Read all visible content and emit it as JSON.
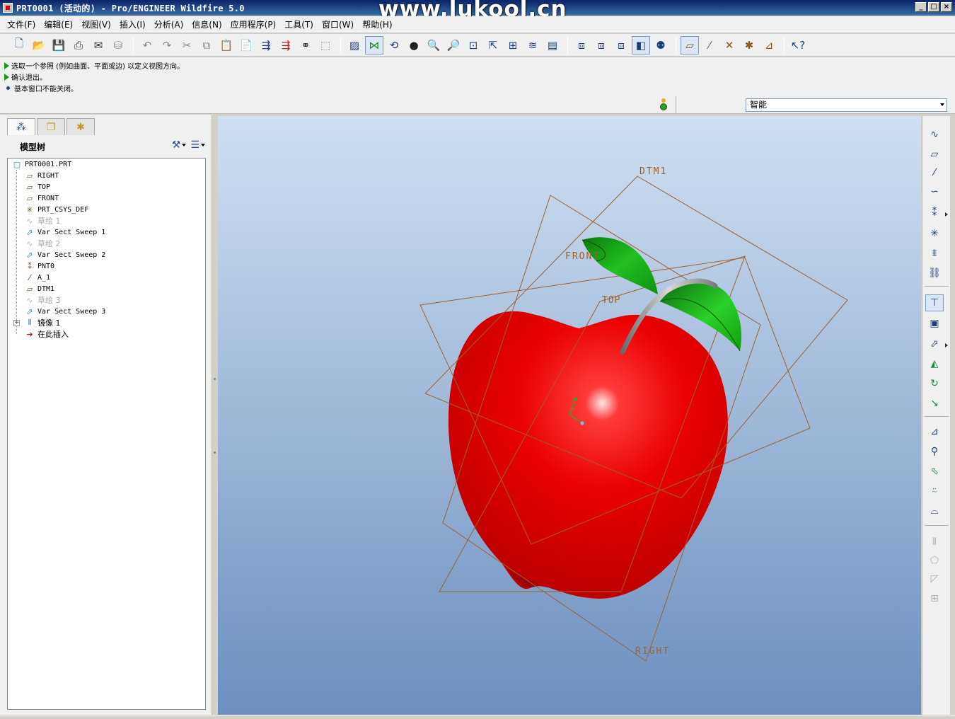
{
  "window": {
    "title": "PRT0001 (活动的) - Pro/ENGINEER Wildfire 5.0",
    "watermark": "www.lukool.cn",
    "buttons": {
      "minimize": "_",
      "maximize": "□",
      "close": "×"
    }
  },
  "menu": {
    "items": [
      "文件(F)",
      "编辑(E)",
      "视图(V)",
      "插入(I)",
      "分析(A)",
      "信息(N)",
      "应用程序(P)",
      "工具(T)",
      "窗口(W)",
      "帮助(H)"
    ]
  },
  "messages": [
    {
      "type": "prompt",
      "text": "选取一个参照 (例如曲面、平面或边) 以定义视图方向。"
    },
    {
      "type": "prompt",
      "text": "确认退出。"
    },
    {
      "type": "info",
      "text": "基本窗口不能关闭。"
    }
  ],
  "filter": {
    "value": "智能"
  },
  "model_tree": {
    "title": "模型树",
    "items": [
      {
        "label": "PRT0001.PRT",
        "icon": "part-icon",
        "state": "normal"
      },
      {
        "label": "RIGHT",
        "icon": "datum-plane-icon",
        "state": "normal"
      },
      {
        "label": "TOP",
        "icon": "datum-plane-icon",
        "state": "normal"
      },
      {
        "label": "FRONT",
        "icon": "datum-plane-icon",
        "state": "normal"
      },
      {
        "label": "PRT_CSYS_DEF",
        "icon": "csys-icon",
        "state": "normal"
      },
      {
        "label": "草绘 1",
        "icon": "sketch-icon",
        "state": "hidden"
      },
      {
        "label": "Var Sect Sweep 1",
        "icon": "var-sect-sweep-icon",
        "state": "normal"
      },
      {
        "label": "草绘 2",
        "icon": "sketch-icon",
        "state": "hidden"
      },
      {
        "label": "Var Sect Sweep 2",
        "icon": "var-sect-sweep-icon",
        "state": "normal"
      },
      {
        "label": "PNT0",
        "icon": "datum-point-icon",
        "state": "normal"
      },
      {
        "label": "A_1",
        "icon": "datum-axis-icon",
        "state": "normal"
      },
      {
        "label": "DTM1",
        "icon": "datum-plane-icon",
        "state": "normal"
      },
      {
        "label": "草绘 3",
        "icon": "sketch-icon",
        "state": "hidden"
      },
      {
        "label": "Var Sect Sweep 3",
        "icon": "var-sect-sweep-icon",
        "state": "normal"
      },
      {
        "label": "镜像 1",
        "icon": "mirror-icon",
        "state": "normal"
      },
      {
        "label": "在此插入",
        "icon": "insert-here-icon",
        "state": "normal"
      }
    ]
  },
  "viewport": {
    "datum_labels": {
      "dtm1": "DTM1",
      "front": "FRONT",
      "top": "TOP",
      "right": "RIGHT"
    },
    "colors": {
      "apple": "#e00000",
      "leaf": "#1cb01c",
      "stem": "#8a8a8a",
      "datum_plane": "#a0602a",
      "bg_top": "#d0dff1",
      "bg_bottom": "#6b8fbf"
    }
  }
}
